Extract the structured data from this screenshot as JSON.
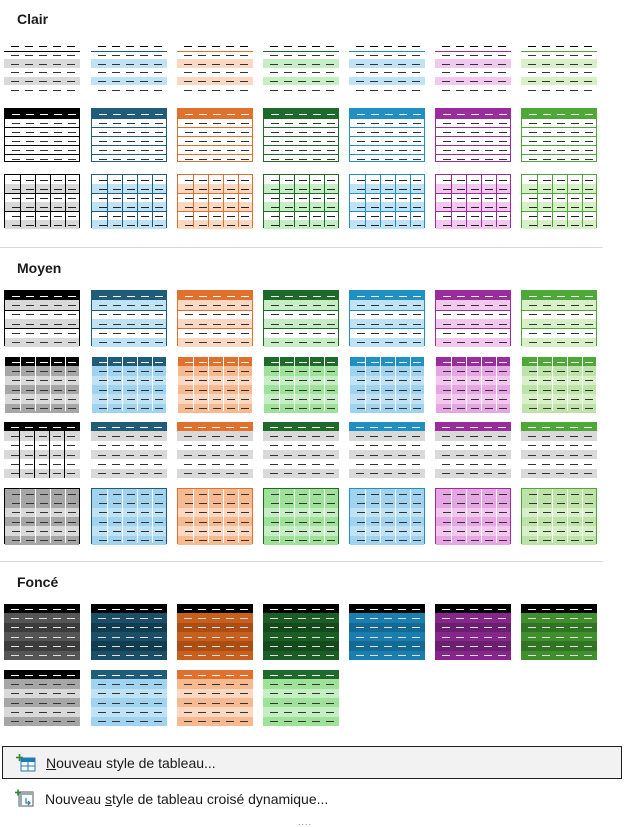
{
  "sections": [
    {
      "id": "clair",
      "title": "Clair"
    },
    {
      "id": "moyen",
      "title": "Moyen"
    },
    {
      "id": "fonce",
      "title": "Foncé"
    }
  ],
  "palette": {
    "black": "#000000",
    "blue": "#1f5c7a",
    "orange": "#e0702b",
    "green": "#1e6a2a",
    "cyan": "#1f8fc4",
    "purple": "#9b2c9b",
    "lime": "#4ea838"
  },
  "menu": {
    "new_table_style": {
      "accel": "N",
      "rest": "ouveau style de tableau..."
    },
    "new_pivot_style": {
      "pre": "Nouveau ",
      "accel": "s",
      "rest": "tyle de tableau croisé dynamique..."
    }
  },
  "footer": {
    "grip": "...."
  }
}
